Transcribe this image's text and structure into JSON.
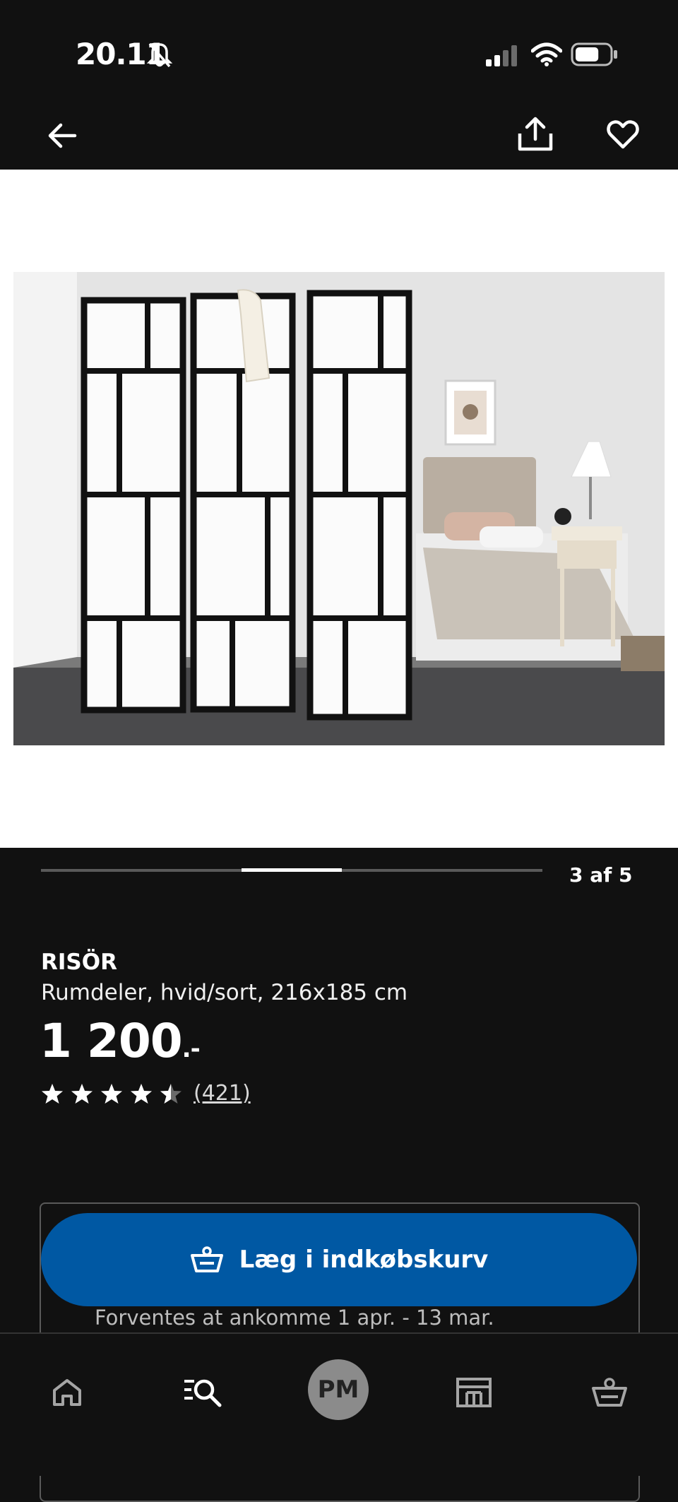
{
  "status_bar": {
    "time": "20.11",
    "battery_level": 0.7
  },
  "nav": {
    "back_icon": "arrow-left-icon",
    "share_icon": "share-icon",
    "favorite_icon": "heart-outline-icon"
  },
  "gallery": {
    "image_alt": "RISÖR room divider product photo",
    "current_index": 3,
    "total": 5,
    "counter_text": "3 af 5"
  },
  "product": {
    "name": "RISÖR",
    "description": "Rumdeler, hvid/sort, 216x185 cm",
    "price": "1 200",
    "price_suffix": ".-",
    "rating": 4.5,
    "review_count": "(421)"
  },
  "cart": {
    "button_label": "Læg i indkøbskurv",
    "delivery_text": "Forventes at ankomme 1 apr. - 13 mar."
  },
  "tab_bar": {
    "items": [
      {
        "name": "home",
        "icon": "home-icon"
      },
      {
        "name": "search",
        "icon": "search-list-icon"
      },
      {
        "name": "profile",
        "avatar_text": "PM"
      },
      {
        "name": "store",
        "icon": "store-icon"
      },
      {
        "name": "cart",
        "icon": "basket-icon"
      }
    ]
  },
  "colors": {
    "accent": "#0058a3",
    "background": "#111111",
    "avatar": "#8b8b8b"
  }
}
